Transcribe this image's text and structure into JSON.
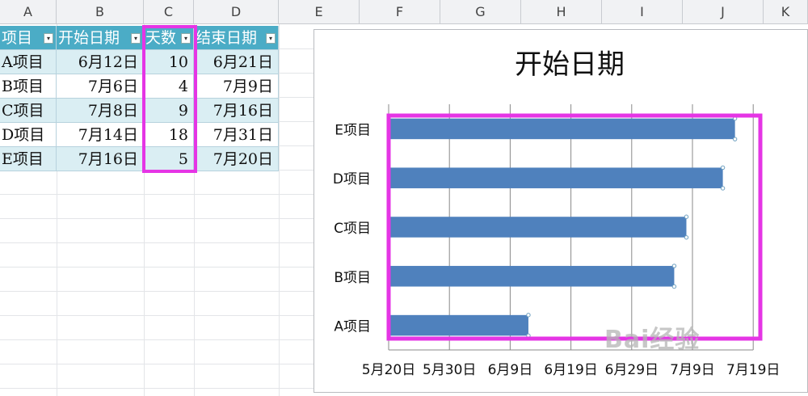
{
  "sheet": {
    "columns": [
      "A",
      "B",
      "C",
      "D",
      "E",
      "F",
      "G",
      "H",
      "I",
      "J",
      "K"
    ],
    "headers": [
      "项目",
      "开始日期",
      "天数",
      "结束日期"
    ],
    "rows": [
      {
        "item": "A项目",
        "start": "6月12日",
        "days": "10",
        "end": "6月21日"
      },
      {
        "item": "B项目",
        "start": "7月6日",
        "days": "4",
        "end": "7月9日"
      },
      {
        "item": "C项目",
        "start": "7月8日",
        "days": "9",
        "end": "7月16日"
      },
      {
        "item": "D项目",
        "start": "7月14日",
        "days": "18",
        "end": "7月31日"
      },
      {
        "item": "E项目",
        "start": "7月16日",
        "days": "5",
        "end": "7月20日"
      }
    ],
    "filter_glyph": "▾"
  },
  "colors": {
    "header_fill": "#4bacc6",
    "band_fill": "#daeef3",
    "bar_fill": "#4f81bd",
    "highlight": "#e535e5"
  },
  "chart_data": {
    "type": "bar",
    "orientation": "horizontal",
    "title": "开始日期",
    "categories": [
      "A项目",
      "B项目",
      "C项目",
      "D项目",
      "E项目"
    ],
    "series": [
      {
        "values": [
          "2014-06-12",
          "2014-07-06",
          "2014-07-08",
          "2014-07-14",
          "2014-07-16"
        ]
      }
    ],
    "x_ticks": [
      "5月20日",
      "5月30日",
      "6月9日",
      "6月19日",
      "6月29日",
      "7月9日",
      "7月19日"
    ],
    "xlim": [
      "2014-05-20",
      "2014-07-19"
    ],
    "grid": true,
    "legend": "none"
  },
  "watermark": "Bai经验"
}
